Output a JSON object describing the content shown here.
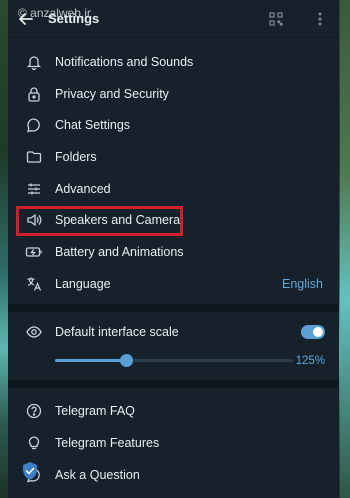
{
  "header": {
    "title": "Settings",
    "watermark": "© anzalweb.ir"
  },
  "menu": [
    {
      "label": "Notifications and Sounds",
      "icon": "bell-icon"
    },
    {
      "label": "Privacy and Security",
      "icon": "lock-icon"
    },
    {
      "label": "Chat Settings",
      "icon": "chat-icon"
    },
    {
      "label": "Folders",
      "icon": "folder-icon"
    },
    {
      "label": "Advanced",
      "icon": "sliders-icon"
    },
    {
      "label": "Speakers and Camera",
      "icon": "speaker-icon"
    },
    {
      "label": "Battery and Animations",
      "icon": "battery-icon"
    },
    {
      "label": "Language",
      "icon": "translate-icon",
      "value": "English"
    }
  ],
  "scale": {
    "label": "Default interface scale",
    "toggle_on": true,
    "value_label": "125%",
    "level": 0.3
  },
  "help": [
    {
      "label": "Telegram FAQ",
      "icon": "help-circle-icon"
    },
    {
      "label": "Telegram Features",
      "icon": "lightbulb-icon"
    },
    {
      "label": "Ask a Question",
      "icon": "chat-question-icon"
    }
  ],
  "colors": {
    "accent": "#5a9fd6",
    "highlight_box": "#d11f2a",
    "panel_bg": "#17212b"
  }
}
